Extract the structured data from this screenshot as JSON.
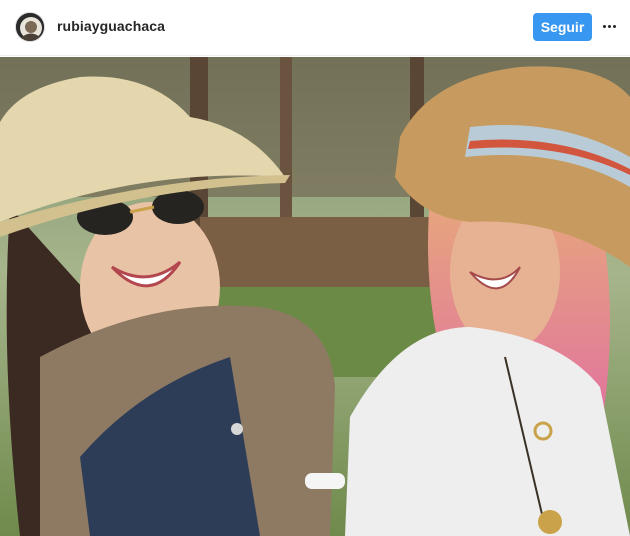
{
  "header": {
    "username": "rubiayguachaca",
    "follow_label": "Seguir",
    "more_icon": "more-options-icon",
    "avatar_icon": "profile-avatar"
  },
  "photo": {
    "alt_icon": "post-photo"
  },
  "colors": {
    "follow_button": "#3897f0",
    "username": "#262626",
    "divider": "#efefef"
  }
}
